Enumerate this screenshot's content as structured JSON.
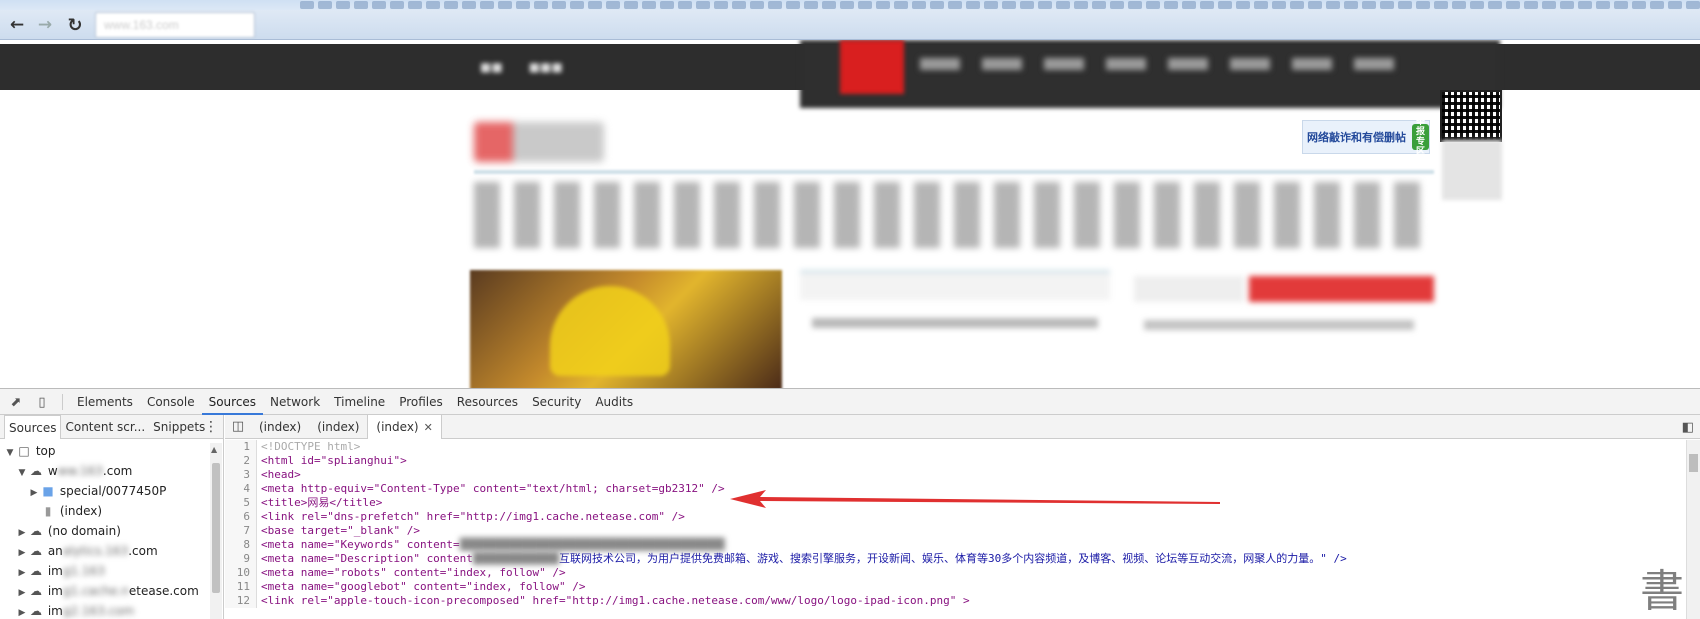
{
  "browser": {
    "back_icon": "back-arrow-icon",
    "forward_icon": "forward-arrow-icon",
    "reload_icon": "reload-icon",
    "address": "www.163.com"
  },
  "ad": {
    "title": "网络敲诈和有偿删帖",
    "badge": "举报专区"
  },
  "devtools": {
    "main_tabs": [
      "Elements",
      "Console",
      "Sources",
      "Network",
      "Timeline",
      "Profiles",
      "Resources",
      "Security",
      "Audits"
    ],
    "active_tab": "Sources",
    "navigator_tabs": [
      "Sources",
      "Content scr...",
      "Snippets"
    ],
    "tree": [
      {
        "label": "top",
        "indent": 0
      },
      {
        "label_start": "w",
        "label_blurred": "ww.163",
        "label_end": ".com",
        "indent": 1
      },
      {
        "label": "special/0077450P",
        "indent": 2
      },
      {
        "label": "(index)",
        "indent": 3
      },
      {
        "label": "(no domain)",
        "indent": 1
      },
      {
        "label_start": "an",
        "label_blurred": "alytics.163",
        "label_end": ".com",
        "indent": 1
      },
      {
        "label_start": "im",
        "label_blurred": "g1.163",
        "label_end": "",
        "indent": 1
      },
      {
        "label_start": "im",
        "label_blurred": "g1.cache.n",
        "label_end": "etease.com",
        "indent": 1
      },
      {
        "label_start": "im",
        "label_blurred": "g2.163.com",
        "label_end": "",
        "indent": 1
      }
    ],
    "editor_tabs": [
      "(index)",
      "(index)",
      "(index)"
    ],
    "code_lines": [
      "<!DOCTYPE html>",
      "<html id=\"spLianghui\">",
      "<head>",
      "<meta http-equiv=\"Content-Type\" content=\"text/html; charset=gb2312\" />",
      "<title>网易</title>",
      "<link rel=\"dns-prefetch\" href=\"http://img1.cache.netease.com\" />",
      "<base target=\"_blank\" />",
      "<meta name=\"Keywords\" content=",
      "<meta name=\"Description\" content",
      "<meta name=\"robots\" content=\"index, follow\" />",
      "<meta name=\"googlebot\" content=\"index, follow\" />",
      "<link rel=\"apple-touch-icon-precomposed\" href=\"http://img1.cache.netease.com/www/logo/logo-ipad-icon.png\" >"
    ],
    "description_tail": "互联网技术公司，为用户提供免费邮箱、游戏、搜索引擎服务，开设新闻、娱乐、体育等30多个内容频道，及博客、视频、论坛等互动交流，网聚人的力量。\" />"
  },
  "colors": {
    "accent": "#3879d9",
    "arrow": "#e03030",
    "topbar": "#2d2d2d",
    "brand_red": "#d91f1f"
  },
  "watermark": "書"
}
